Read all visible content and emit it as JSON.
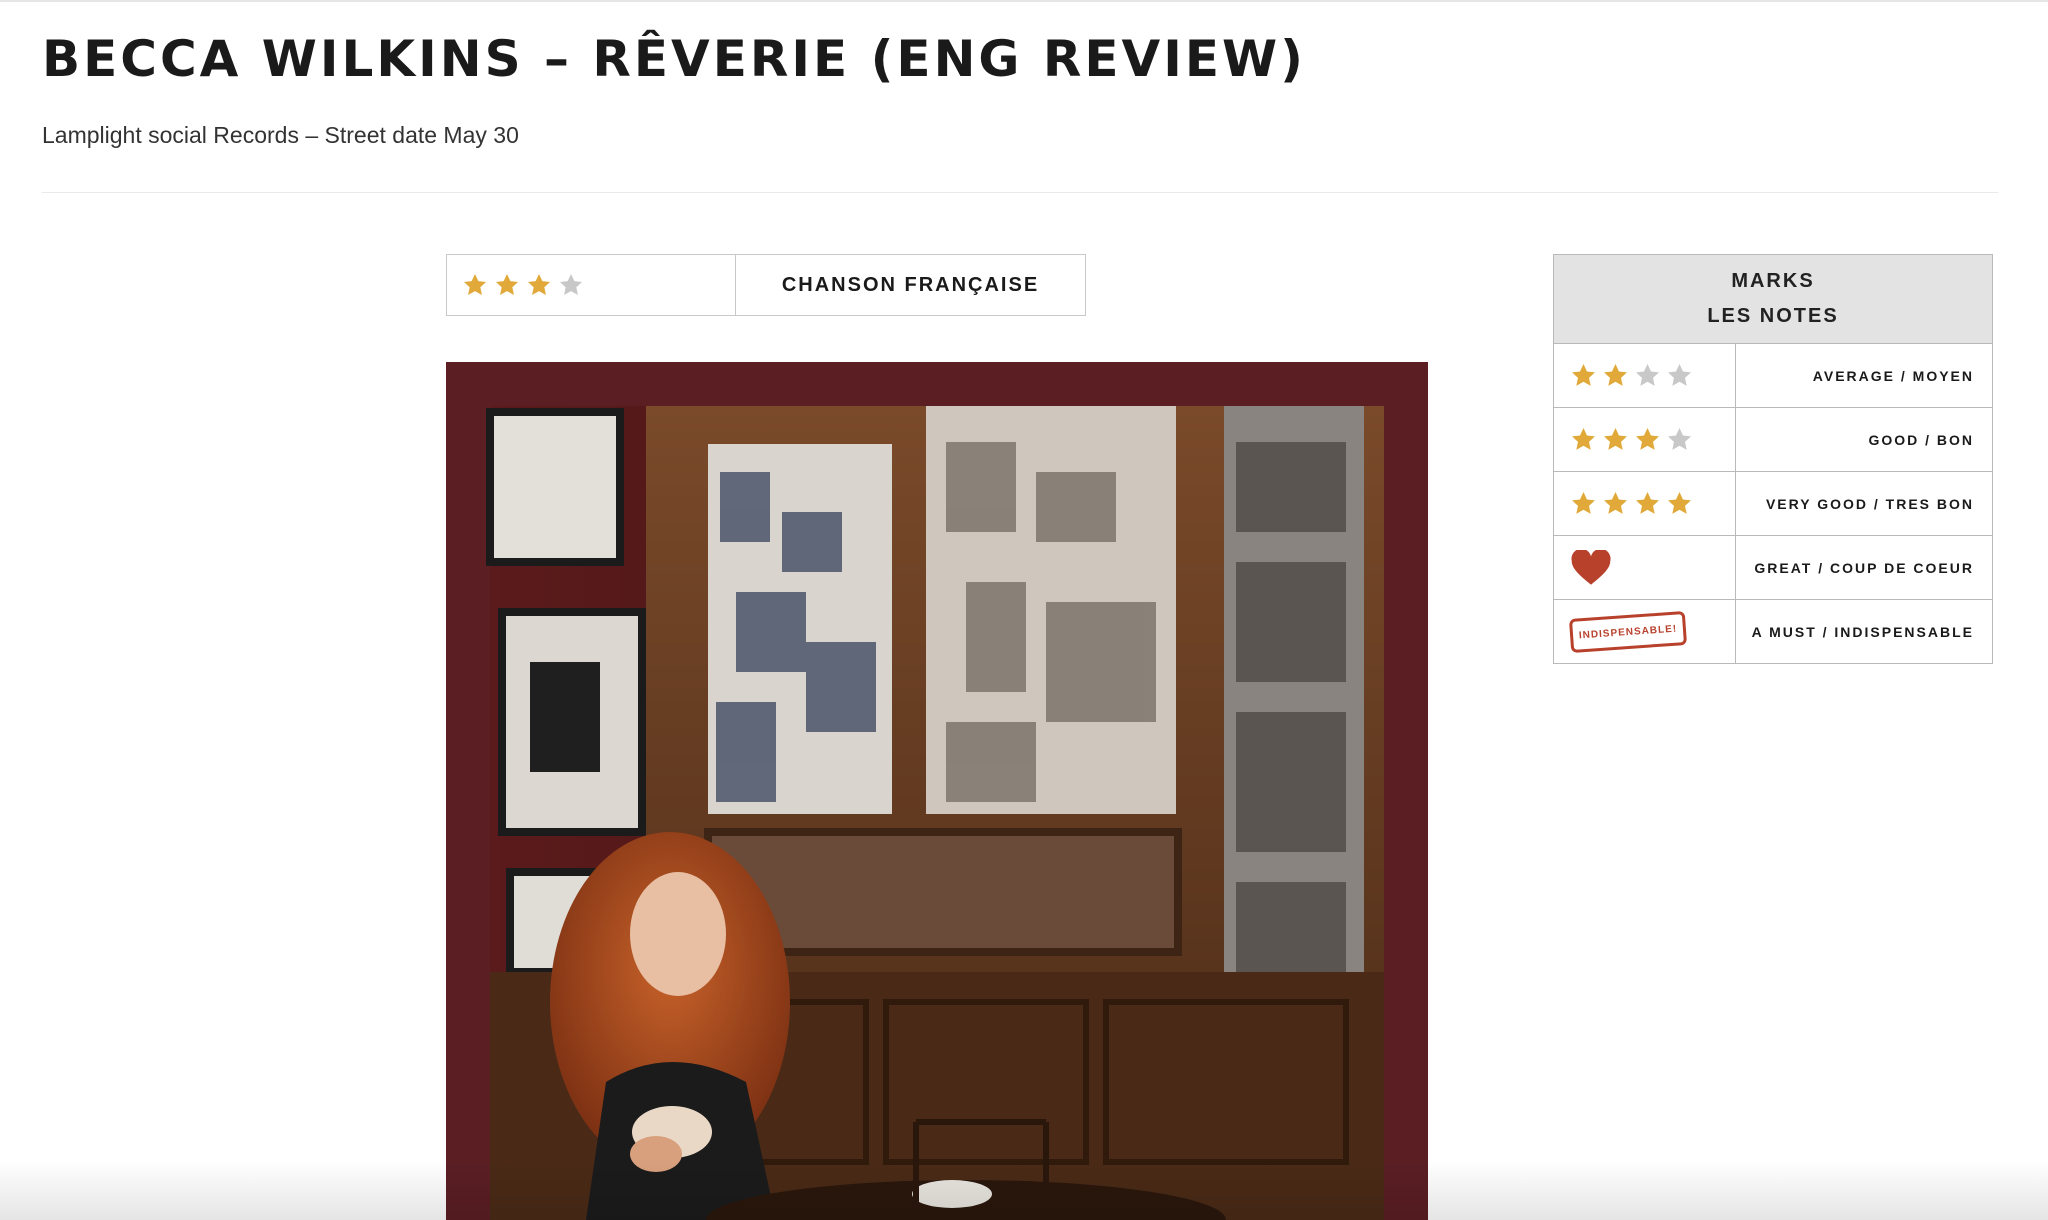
{
  "article": {
    "title": "BECCA WILKINS – RÊVERIE (ENG REVIEW)",
    "subtitle": "Lamplight social Records – Street date May 30"
  },
  "rating": {
    "stars_filled": 3,
    "stars_total": 4,
    "genre": "CHANSON FRANÇAISE"
  },
  "marks": {
    "heading_en": "MARKS",
    "heading_fr": "LES NOTES",
    "rows": [
      {
        "icon": "stars",
        "filled": 2,
        "total": 4,
        "label": "AVERAGE / MOYEN"
      },
      {
        "icon": "stars",
        "filled": 3,
        "total": 4,
        "label": "GOOD / BON"
      },
      {
        "icon": "stars",
        "filled": 4,
        "total": 4,
        "label": "VERY GOOD / TRES BON"
      },
      {
        "icon": "heart-icon",
        "label": "GREAT / COUP DE COEUR"
      },
      {
        "icon": "stamp-icon",
        "stamp_text": "INDISPENSABLE!",
        "label": "A MUST / INDISPENSABLE"
      }
    ]
  },
  "cover": {
    "alt": "Album cover photo",
    "frame_color": "#5a1e23"
  },
  "colors": {
    "star_gold": "#e0a93a",
    "star_gray": "#c8c8c8",
    "accent_red": "#b8412c"
  }
}
